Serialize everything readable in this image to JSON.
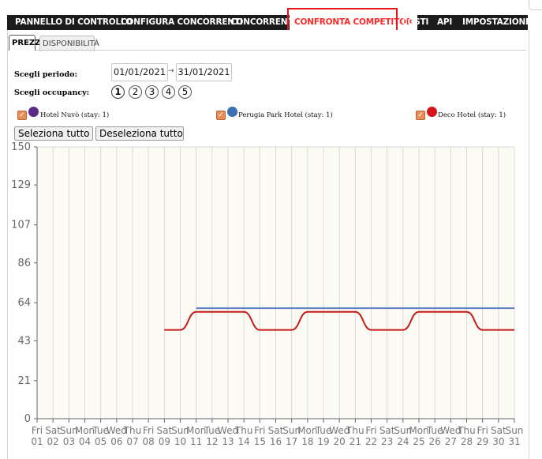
{
  "nav": {
    "items": [
      {
        "label": "PANNELLO DI CONTROLLO"
      },
      {
        "label": "CONFIGURA CONCORRENTI"
      },
      {
        "label": "CONCORRENTI"
      },
      {
        "label": "CONFRONTA COMPETITOR",
        "active": true
      },
      {
        "label": "COSTI"
      },
      {
        "label": "API"
      },
      {
        "label": "IMPOSTAZIONI"
      }
    ]
  },
  "tabs": [
    {
      "label": "PREZZI",
      "active": true
    },
    {
      "label": "DISPONIBILITÀ",
      "active": false
    }
  ],
  "filters": {
    "period_label": "Scegli periodo:",
    "date_from": "01/01/2021",
    "date_sep": "→",
    "date_to": "31/01/2021",
    "occupancy_label": "Scegli occupancy:",
    "occupancy_options": [
      "1",
      "2",
      "3",
      "4",
      "5"
    ],
    "occupancy_selected": "1"
  },
  "hotels": [
    {
      "label": "Hotel Nuvò (stay: 1)",
      "color": "#5b2a86",
      "checked": true
    },
    {
      "label": "Perugia Park Hotel (stay: 1)",
      "color": "#3c6fb4",
      "checked": true
    },
    {
      "label": "Deco Hotel (stay: 1)",
      "color": "#d6141c",
      "checked": true
    }
  ],
  "buttons": {
    "select_all": "Seleziona tutto",
    "deselect_all": "Deseleziona tutto"
  },
  "chart_data": {
    "type": "line",
    "ylim": [
      0,
      150
    ],
    "yticks": [
      0,
      21,
      43,
      64,
      86,
      107,
      129,
      150
    ],
    "x_days": [
      "Fri",
      "Sat",
      "Sun",
      "Mon",
      "Tue",
      "Wed",
      "Thu",
      "Fri",
      "Sat",
      "Sun",
      "Mon",
      "Tue",
      "Wed",
      "Thu",
      "Fri",
      "Sat",
      "Sun",
      "Mon",
      "Tue",
      "Wed",
      "Thu",
      "Fri",
      "Sat",
      "Sun",
      "Mon",
      "Tue",
      "Wed",
      "Thu",
      "Fri",
      "Sat",
      "Sun"
    ],
    "x_dates": [
      "01",
      "02",
      "03",
      "04",
      "05",
      "06",
      "07",
      "08",
      "09",
      "10",
      "11",
      "12",
      "13",
      "14",
      "15",
      "16",
      "17",
      "18",
      "19",
      "20",
      "21",
      "22",
      "23",
      "24",
      "25",
      "26",
      "27",
      "28",
      "29",
      "30",
      "31"
    ],
    "grid": true,
    "series": [
      {
        "name": "Perugia Park Hotel (stay: 1)",
        "color": "#5b7fc0",
        "values": [
          null,
          null,
          null,
          null,
          null,
          null,
          null,
          null,
          null,
          null,
          61,
          61,
          61,
          61,
          61,
          61,
          61,
          61,
          61,
          61,
          61,
          61,
          61,
          61,
          61,
          61,
          61,
          61,
          61,
          61,
          61
        ]
      },
      {
        "name": "Deco Hotel (stay: 1)",
        "color": "#c41a1a",
        "values": [
          null,
          null,
          null,
          null,
          null,
          null,
          null,
          null,
          49,
          49,
          59,
          59,
          59,
          59,
          49,
          49,
          49,
          59,
          59,
          59,
          59,
          49,
          49,
          49,
          59,
          59,
          59,
          59,
          49,
          49,
          49
        ]
      }
    ]
  }
}
